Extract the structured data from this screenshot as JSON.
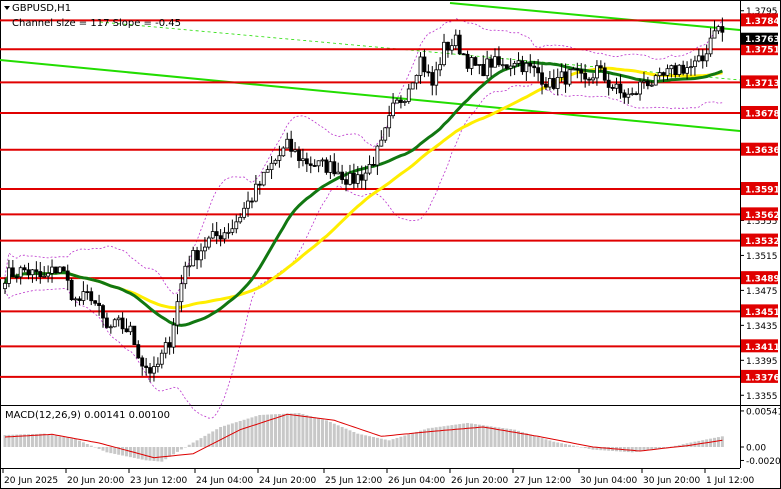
{
  "header": {
    "symbol_tf": "GBPUSD,H1",
    "channel_info": "Channel size = 117 Slope = -0.45",
    "macd_label": "MACD(12,26,9) 0.00141 0.00100"
  },
  "colors": {
    "candle": "#000000",
    "level_line": "#e00000",
    "level_label_bg": "#e00000",
    "channel": "#22dd00",
    "ma_fast": "#117711",
    "ma_slow": "#ffee00",
    "bollinger": "#bb33cc",
    "macd_hist": "#c8c8c8",
    "macd_signal": "#dd0000",
    "current_price_bg": "#000000"
  },
  "chart_data": {
    "type": "candlestick",
    "symbol": "GBPUSD",
    "timeframe": "H1",
    "ylim": [
      1.3345,
      1.3805
    ],
    "price_ticks": [
      1.3795,
      1.3755,
      1.3675,
      1.3595,
      1.3555,
      1.3515,
      1.3475,
      1.3435,
      1.3395,
      1.3355
    ],
    "x_labels": [
      "20 Jun 2025",
      "20 Jun 20:00",
      "23 Jun 12:00",
      "24 Jun 04:00",
      "24 Jun 20:00",
      "25 Jun 12:00",
      "26 Jun 04:00",
      "26 Jun 20:00",
      "27 Jun 12:00",
      "30 Jun 04:00",
      "30 Jun 20:00",
      "1 Jul 12:00"
    ],
    "levels": [
      1.3784,
      1.3751,
      1.3713,
      1.3678,
      1.3636,
      1.3591,
      1.3562,
      1.3532,
      1.3489,
      1.3451,
      1.3411,
      1.3376
    ],
    "current_price": 1.3763,
    "channel_slope": -0.45,
    "channel_size": 117,
    "anchors": [
      [
        0,
        1.3492
      ],
      [
        5,
        1.3498
      ],
      [
        10,
        1.3488
      ],
      [
        14,
        1.3504
      ],
      [
        18,
        1.3462
      ],
      [
        22,
        1.347
      ],
      [
        26,
        1.343
      ],
      [
        29,
        1.3436
      ],
      [
        32,
        1.3428
      ],
      [
        35,
        1.3392
      ],
      [
        38,
        1.338
      ],
      [
        42,
        1.3418
      ],
      [
        46,
        1.3504
      ],
      [
        52,
        1.3532
      ],
      [
        58,
        1.3548
      ],
      [
        63,
        1.3582
      ],
      [
        68,
        1.3618
      ],
      [
        72,
        1.364
      ],
      [
        76,
        1.3624
      ],
      [
        80,
        1.3618
      ],
      [
        84,
        1.3616
      ],
      [
        88,
        1.36
      ],
      [
        92,
        1.361
      ],
      [
        96,
        1.364
      ],
      [
        99,
        1.3682
      ],
      [
        102,
        1.37
      ],
      [
        106,
        1.374
      ],
      [
        109,
        1.371
      ],
      [
        112,
        1.3752
      ],
      [
        115,
        1.376
      ],
      [
        118,
        1.3738
      ],
      [
        121,
        1.3726
      ],
      [
        124,
        1.3736
      ],
      [
        127,
        1.373
      ],
      [
        130,
        1.374
      ],
      [
        133,
        1.373
      ],
      [
        136,
        1.3724
      ],
      [
        139,
        1.371
      ],
      [
        142,
        1.3718
      ],
      [
        145,
        1.3722
      ],
      [
        148,
        1.3712
      ],
      [
        151,
        1.3728
      ],
      [
        154,
        1.3712
      ],
      [
        157,
        1.37
      ],
      [
        160,
        1.3696
      ],
      [
        163,
        1.3716
      ],
      [
        166,
        1.3712
      ],
      [
        169,
        1.3722
      ],
      [
        172,
        1.373
      ],
      [
        175,
        1.373
      ],
      [
        178,
        1.3738
      ],
      [
        181,
        1.3778
      ],
      [
        183,
        1.377
      ]
    ],
    "macd": {
      "ylim": [
        -0.003,
        0.006
      ],
      "tick_labels": [
        "0.00541",
        "0.00",
        "-0.00202"
      ],
      "tick_values": [
        0.00541,
        0.0,
        -0.00202
      ],
      "hist_anchors": [
        [
          0,
          0.0018
        ],
        [
          10,
          0.002
        ],
        [
          18,
          0.0012
        ],
        [
          26,
          -0.0008
        ],
        [
          36,
          -0.002
        ],
        [
          40,
          -0.0022
        ],
        [
          46,
          0.0
        ],
        [
          55,
          0.003
        ],
        [
          65,
          0.0048
        ],
        [
          75,
          0.0051
        ],
        [
          82,
          0.004
        ],
        [
          90,
          0.002
        ],
        [
          98,
          0.001
        ],
        [
          108,
          0.0028
        ],
        [
          118,
          0.0036
        ],
        [
          130,
          0.0026
        ],
        [
          140,
          0.0008
        ],
        [
          150,
          -0.0004
        ],
        [
          160,
          -0.0008
        ],
        [
          168,
          -0.0002
        ],
        [
          176,
          0.0008
        ],
        [
          183,
          0.0016
        ]
      ],
      "signal_anchors": [
        [
          0,
          0.0015
        ],
        [
          12,
          0.0019
        ],
        [
          24,
          0.0006
        ],
        [
          38,
          -0.0016
        ],
        [
          48,
          -0.001
        ],
        [
          60,
          0.0026
        ],
        [
          72,
          0.0049
        ],
        [
          84,
          0.004
        ],
        [
          96,
          0.0016
        ],
        [
          110,
          0.0024
        ],
        [
          122,
          0.003
        ],
        [
          136,
          0.0016
        ],
        [
          150,
          0.0
        ],
        [
          162,
          -0.0006
        ],
        [
          174,
          0.0002
        ],
        [
          183,
          0.001
        ]
      ]
    }
  }
}
